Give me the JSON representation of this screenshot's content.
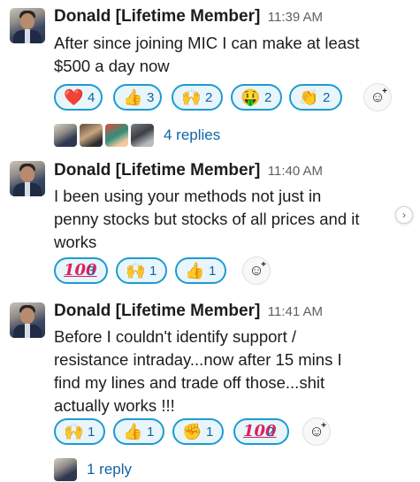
{
  "messages": [
    {
      "author": "Donald [Lifetime Member]",
      "time": "11:39 AM",
      "lines": [
        "After since joining MIC I can make at least",
        "$500 a day now"
      ],
      "reactions": [
        {
          "emoji": "❤️",
          "name": "heart",
          "count": "4"
        },
        {
          "emoji": "👍",
          "name": "thumbsup",
          "count": "3"
        },
        {
          "emoji": "🙌",
          "name": "raised-hands",
          "count": "2"
        },
        {
          "emoji": "🤑",
          "name": "money-mouth",
          "count": "2"
        },
        {
          "emoji": "👏",
          "name": "clap",
          "count": "2"
        }
      ],
      "thread": {
        "reply_text": "4 replies",
        "avatar_count": 4
      }
    },
    {
      "author": "Donald [Lifetime Member]",
      "time": "11:40 AM",
      "lines": [
        "I been using your methods not just in",
        "penny stocks but stocks of all prices and it",
        "works"
      ],
      "reactions": [
        {
          "emoji": "100",
          "name": "hundred",
          "count": "3"
        },
        {
          "emoji": "🙌",
          "name": "raised-hands",
          "count": "1"
        },
        {
          "emoji": "👍",
          "name": "thumbsup",
          "count": "1"
        }
      ]
    },
    {
      "author": "Donald [Lifetime Member]",
      "time": "11:41 AM",
      "lines": [
        "Before I couldn't identify support /",
        "resistance intraday...now after 15 mins I",
        "find my lines and trade off those...shit",
        "actually works !!!"
      ],
      "reactions": [
        {
          "emoji": "🙌",
          "name": "raised-hands",
          "count": "1"
        },
        {
          "emoji": "👍",
          "name": "thumbsup",
          "count": "1"
        },
        {
          "emoji": "✊",
          "name": "fist",
          "count": "1"
        },
        {
          "emoji": "100",
          "name": "hundred",
          "count": "2"
        }
      ],
      "thread": {
        "reply_text": "1 reply",
        "avatar_count": 1
      }
    }
  ],
  "colors": {
    "pill_bg": "#e8f5fa",
    "pill_border": "#1d9bd1",
    "link": "#1264a3",
    "timestamp": "#616061"
  },
  "icons": {
    "add_reaction": "smile-plus-icon",
    "scroll": "chevron-right-icon"
  }
}
